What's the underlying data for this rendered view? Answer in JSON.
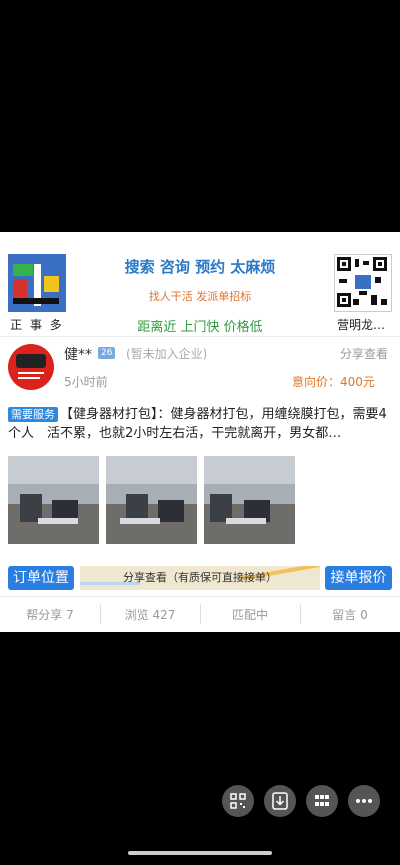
{
  "brand": {
    "caption": "正 事 多"
  },
  "header": {
    "title": "搜索 咨询 预约 太麻烦",
    "subtitle": "找人干活 发派单招标",
    "features": "距离近 上门快 价格低"
  },
  "qr": {
    "caption": "营明龙…"
  },
  "post": {
    "user_name": "健**",
    "user_badge": "26",
    "company": "(暂未加入企业)",
    "share_label": "分享查看",
    "time": "5小时前",
    "price": "意向价：400元",
    "tag": "需要服务",
    "description": "【健身器材打包】：健身器材打包，用缠绕膜打包，需要4个人　活不累，也就2小时左右活，干完就离开，男女都…"
  },
  "actions": {
    "order_location": "订单位置",
    "map_hint": "分享查看（有质保可直接接单）",
    "quote": "接单报价"
  },
  "stats": {
    "share": "帮分享 7",
    "views": "浏览 427",
    "match": "匹配中",
    "comments": "留言 0"
  },
  "fab_icons": [
    "qr-code-icon",
    "download-icon",
    "grid-icon",
    "more-icon"
  ]
}
